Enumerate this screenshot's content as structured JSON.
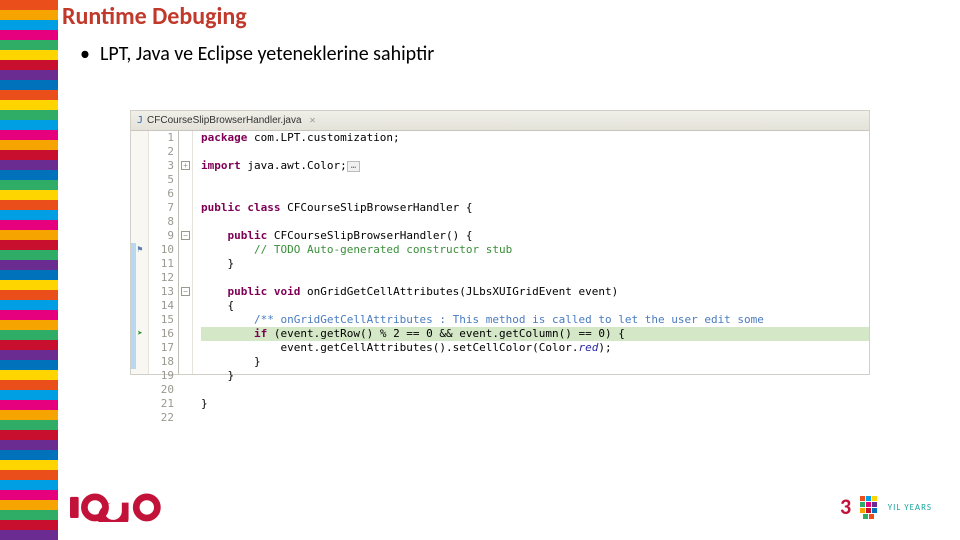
{
  "title": "Runtime Debuging",
  "bullet": "LPT, Java ve Eclipse yeteneklerine sahiptir",
  "editor": {
    "tab": {
      "filename": "CFCourseSlipBrowserHandler.java",
      "close": "✕"
    },
    "lines": [
      {
        "n": 1,
        "html": "<span class='kw'>package</span> com.LPT.customization;"
      },
      {
        "n": 2,
        "html": ""
      },
      {
        "n": 3,
        "html": "<span class='kw'>import</span> java.awt.Color;<span class='fold-box'>…</span>",
        "foldplus": true
      },
      {
        "n": 5,
        "html": ""
      },
      {
        "n": 6,
        "html": ""
      },
      {
        "n": 7,
        "html": "<span class='kw'>public class</span> CFCourseSlipBrowserHandler {"
      },
      {
        "n": 8,
        "html": ""
      },
      {
        "n": 9,
        "html": "    <span class='kw'>public</span> CFCourseSlipBrowserHandler() {",
        "foldminus": true
      },
      {
        "n": 10,
        "html": "        <span class='cm'>// TODO Auto-generated constructor stub</span>",
        "mark": "⚑"
      },
      {
        "n": 11,
        "html": "    }"
      },
      {
        "n": 12,
        "html": ""
      },
      {
        "n": 13,
        "html": "    <span class='kw'>public void</span> onGridGetCellAttributes(JLbsXUIGridEvent event)",
        "foldminus": true
      },
      {
        "n": 14,
        "html": "    {"
      },
      {
        "n": 15,
        "html": "        <span class='jd'>/** onGridGetCellAttributes : This method is called to let the user edit some</span>"
      },
      {
        "n": 16,
        "html": "        <span class='kw'>if</span> (event.getRow() % 2 == 0 && event.getColumn() == 0) {",
        "highlight": true,
        "mark": "➤"
      },
      {
        "n": 17,
        "html": "            event.getCellAttributes().setCellColor(Color.<span style='color:#2a2aa0;font-style:italic'>red</span>);"
      },
      {
        "n": 18,
        "html": "        }"
      },
      {
        "n": 19,
        "html": "    }"
      },
      {
        "n": 20,
        "html": ""
      },
      {
        "n": 21,
        "html": "}"
      },
      {
        "n": 22,
        "html": ""
      }
    ]
  },
  "footer": {
    "years_label": "YIL YEARS"
  },
  "stripe_colors": [
    "#e94e1b",
    "#f6a500",
    "#009fe3",
    "#e6007e",
    "#2fac66",
    "#ffd500",
    "#c8102e",
    "#6b2c91",
    "#0072bc",
    "#e94e1b",
    "#ffd500",
    "#2fac66",
    "#009fe3",
    "#e6007e",
    "#f6a500",
    "#c8102e",
    "#6b2c91",
    "#0072bc",
    "#2fac66",
    "#ffd500",
    "#e94e1b",
    "#009fe3",
    "#e6007e",
    "#f6a500",
    "#c8102e",
    "#2fac66",
    "#6b2c91",
    "#0072bc",
    "#ffd500",
    "#e94e1b",
    "#009fe3",
    "#e6007e",
    "#f6a500",
    "#2fac66",
    "#c8102e",
    "#6b2c91",
    "#0072bc",
    "#ffd500",
    "#e94e1b",
    "#009fe3",
    "#e6007e",
    "#f6a500",
    "#2fac66",
    "#c8102e",
    "#6b2c91",
    "#0072bc",
    "#ffd500",
    "#e94e1b",
    "#009fe3",
    "#e6007e",
    "#f6a500",
    "#2fac66",
    "#c8102e",
    "#6b2c91"
  ]
}
